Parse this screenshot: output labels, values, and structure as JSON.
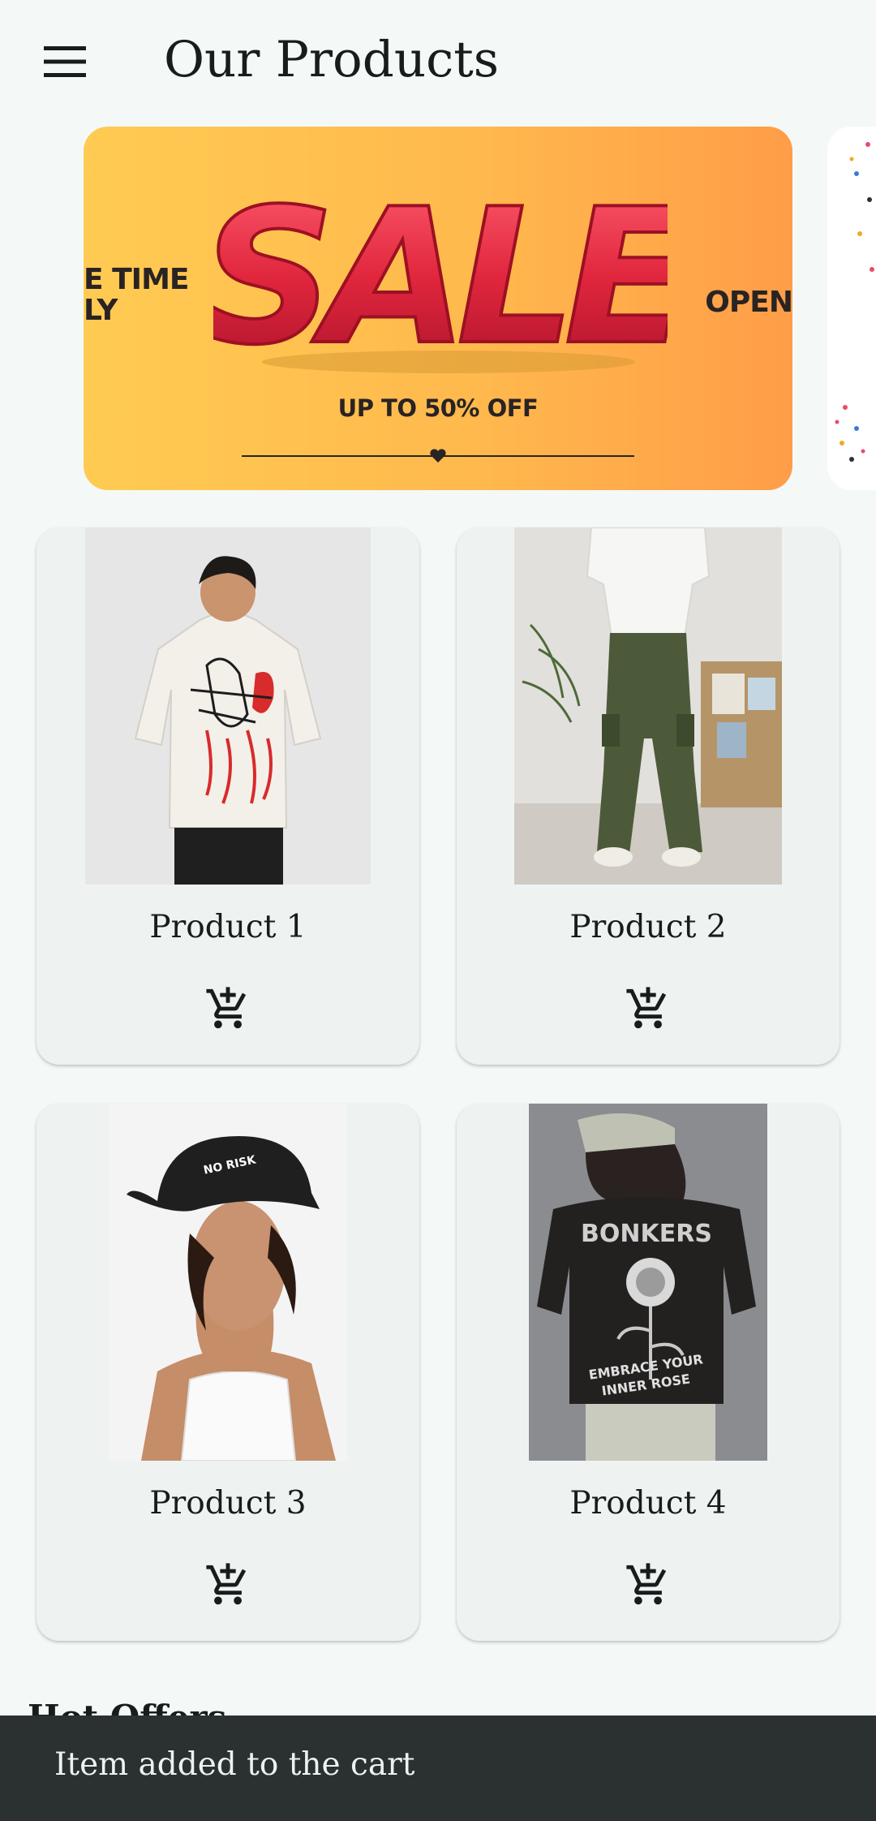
{
  "app_bar": {
    "title": "Our Products",
    "menu_icon": "menu-icon"
  },
  "carousel": {
    "banner": {
      "left_text_line1": "E TIME",
      "left_text_line2": "LY",
      "headline": "SALE",
      "right_text": "OPEN",
      "offer": "UP TO 50% OFF",
      "colors": {
        "start": "#ffcb52",
        "end": "#ff9d48",
        "letters": "#d8233a"
      }
    }
  },
  "products": [
    {
      "name": "Product 1",
      "image": "white graphic tee back view",
      "cart_icon": "add-shopping-cart-icon"
    },
    {
      "name": "Product 2",
      "image": "olive cargo pants with white tee",
      "cart_icon": "add-shopping-cart-icon"
    },
    {
      "name": "Product 3",
      "image": "black trucker cap on model",
      "cart_icon": "add-shopping-cart-icon"
    },
    {
      "name": "Product 4",
      "image": "black rose print tee back view",
      "cart_icon": "add-shopping-cart-icon"
    }
  ],
  "hot_offers": {
    "heading": "Hot Offers"
  },
  "snackbar": {
    "message": "Item added to the cart"
  },
  "colors": {
    "background": "#f4f9f8",
    "card": "#eef3f2",
    "snackbar": "#2b3131",
    "text": "#171d1c"
  }
}
